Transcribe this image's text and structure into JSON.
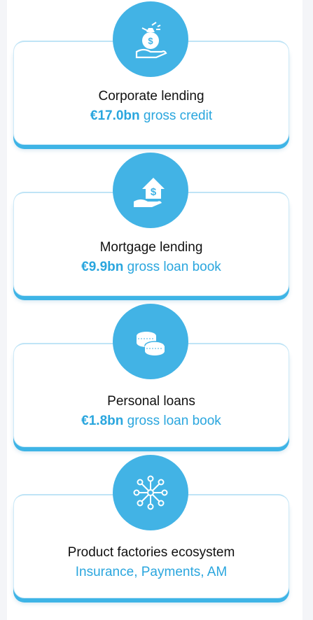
{
  "items": [
    {
      "title": "Corporate lending",
      "value": "€17.0bn",
      "description": "gross credit",
      "icon": "money-bag-hand-icon"
    },
    {
      "title": "Mortgage lending",
      "value": "€9.9bn",
      "description": "gross loan book",
      "icon": "house-hand-icon"
    },
    {
      "title": "Personal loans",
      "value": "€1.8bn",
      "description": "gross loan book",
      "icon": "coins-icon"
    },
    {
      "title": "Product factories ecosystem",
      "value": "",
      "description": "Insurance, Payments, AM",
      "icon": "network-icon"
    }
  ],
  "colors": {
    "accent": "#42b3e5",
    "text_accent": "#2aa6de",
    "card_shadow": "#3eb4e6"
  }
}
